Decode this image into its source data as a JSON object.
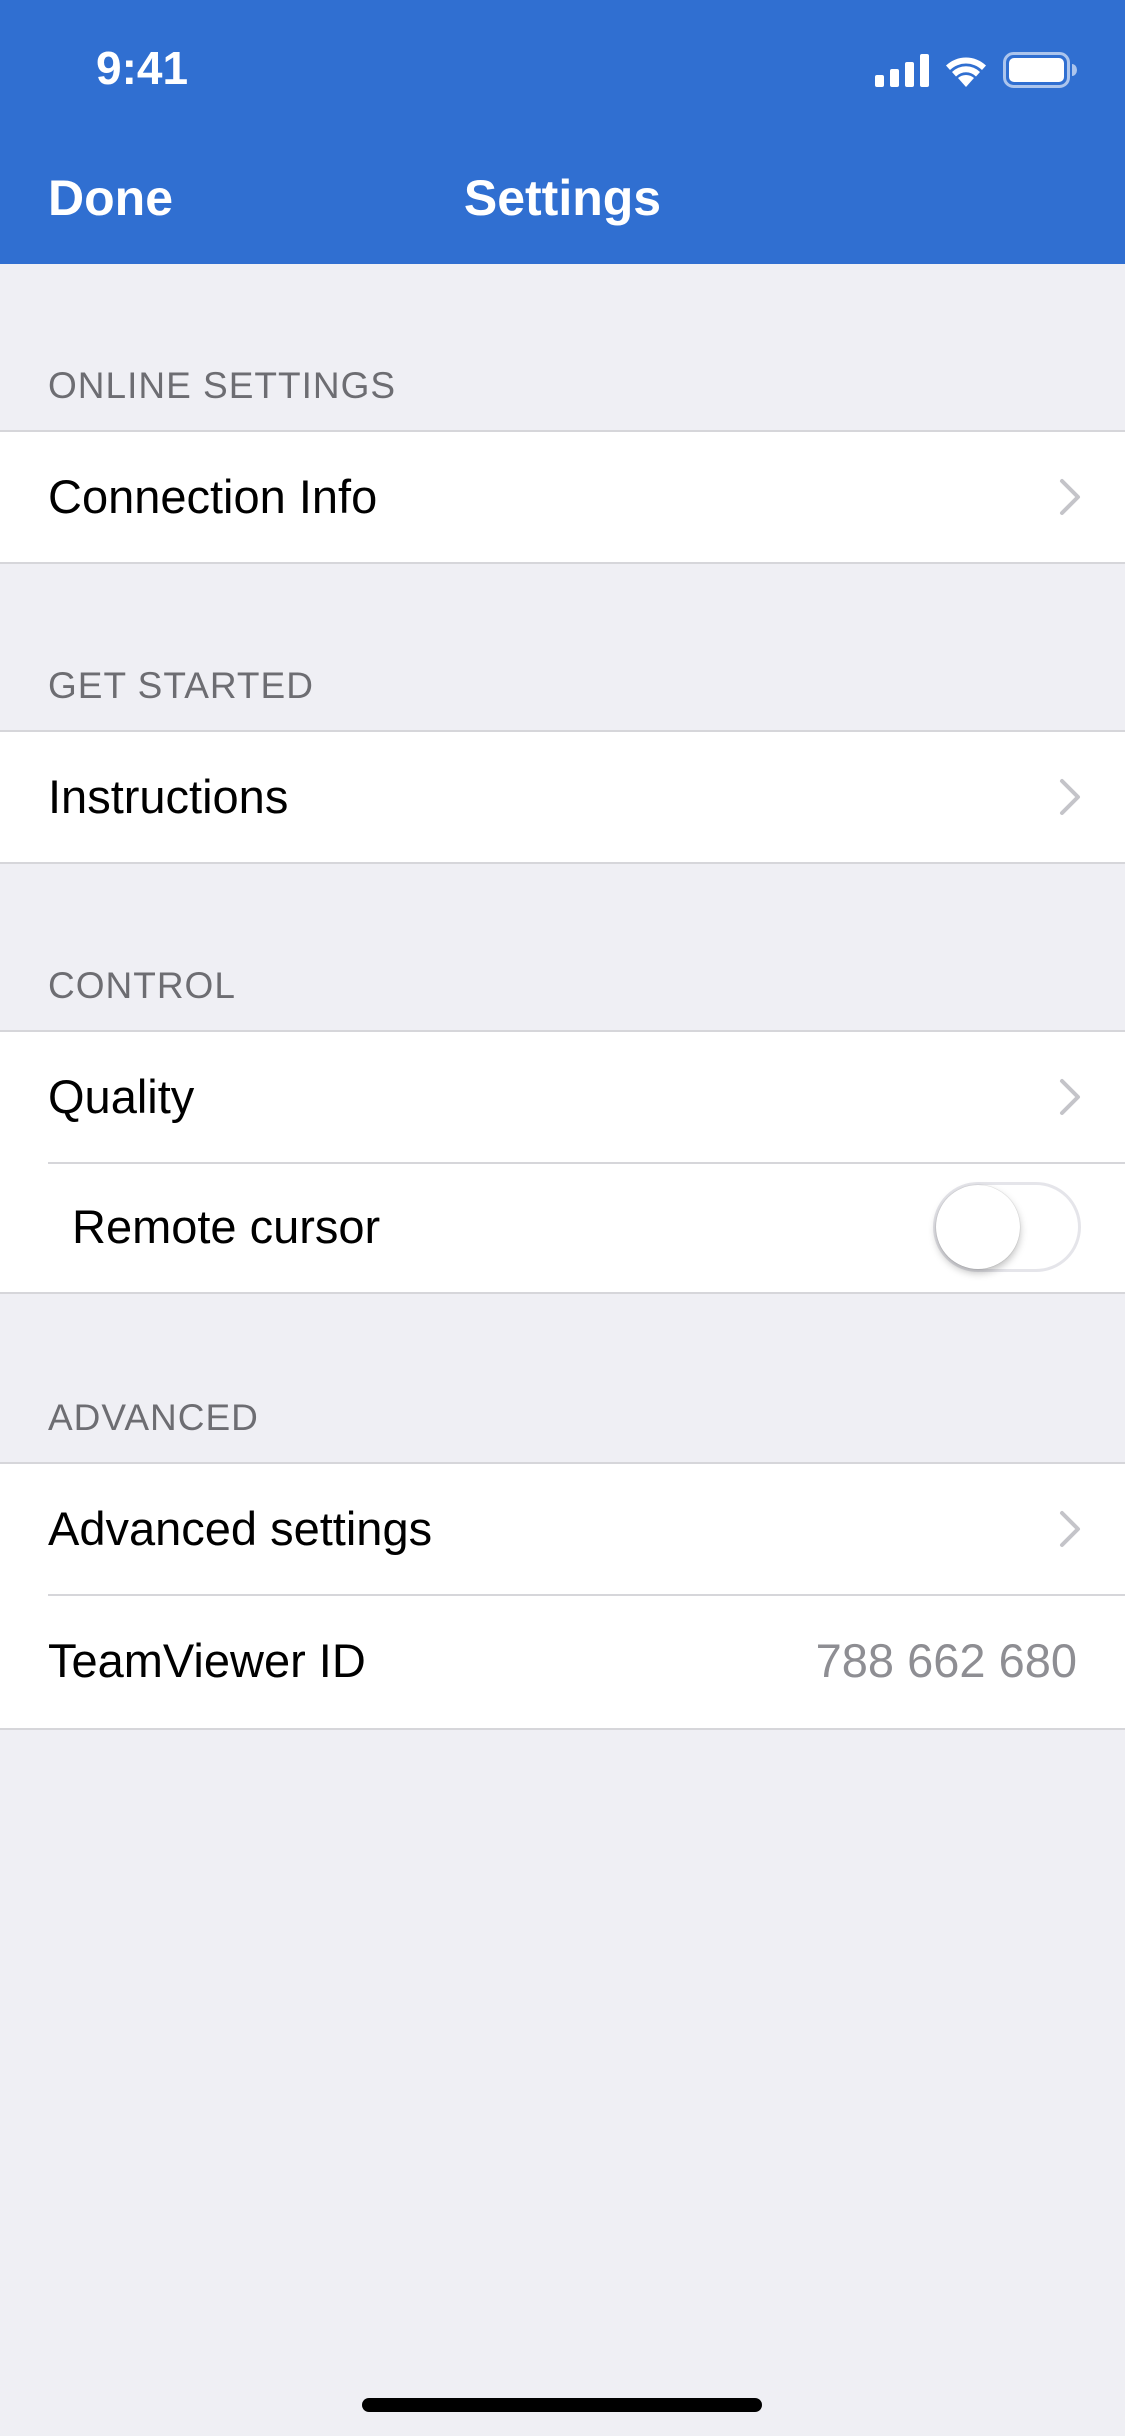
{
  "status_bar": {
    "time": "9:41",
    "icons": [
      "cellular-signal-icon",
      "wifi-icon",
      "battery-icon"
    ]
  },
  "nav": {
    "done_label": "Done",
    "title": "Settings"
  },
  "sections": {
    "online": {
      "header": "ONLINE SETTINGS",
      "connection_info": "Connection Info"
    },
    "get_started": {
      "header": "GET STARTED",
      "instructions": "Instructions"
    },
    "control": {
      "header": "CONTROL",
      "quality": "Quality",
      "remote_cursor": "Remote cursor",
      "remote_cursor_on": false
    },
    "advanced": {
      "header": "ADVANCED",
      "advanced_settings": "Advanced settings",
      "teamviewer_id_label": "TeamViewer ID",
      "teamviewer_id_value": "788 662 680"
    }
  },
  "colors": {
    "accent": "#306fd1",
    "background": "#efeff4",
    "secondary_text": "#8e8e93"
  }
}
